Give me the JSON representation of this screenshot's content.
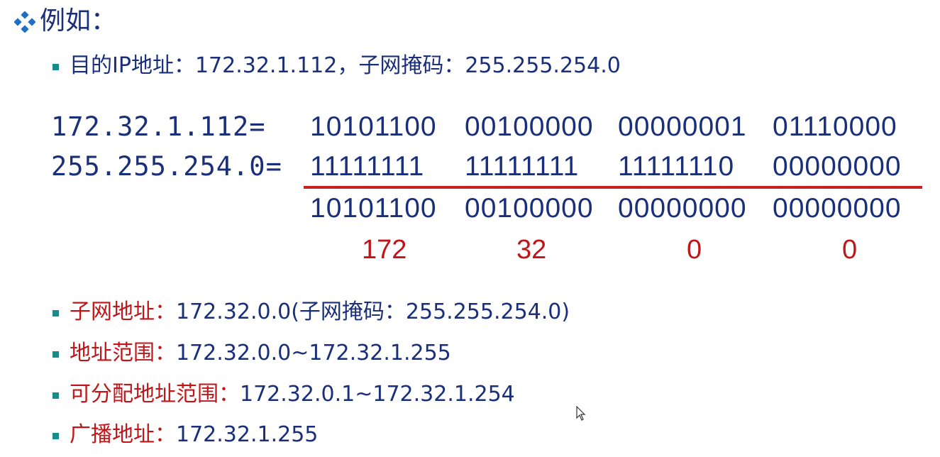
{
  "heading": {
    "text": "例如：",
    "icon": "diamond-bullet-icon"
  },
  "intro": {
    "label": "目的IP地址：",
    "ip": "172.32.1.112",
    "sep": "，",
    "mask_label": "子网掩码：",
    "mask": "255.255.254.0"
  },
  "calc": {
    "ip_label": "172.32.1.112=",
    "mask_label": "255.255.254.0=",
    "ip_bits": [
      "10101100",
      "00100000",
      "00000001",
      "01110000"
    ],
    "mask_bits": [
      "11111111",
      "11111111",
      "11111110",
      "00000000"
    ],
    "result_bits": [
      "10101100",
      "00100000",
      "00000000",
      "00000000"
    ],
    "result_dec": [
      "172",
      "32",
      "0",
      "0"
    ]
  },
  "results": [
    {
      "label": "子网地址：",
      "value": "172.32.0.0(子网掩码：255.255.254.0)"
    },
    {
      "label": "地址范围：",
      "value": "172.32.0.0~172.32.1.255"
    },
    {
      "label": "可分配地址范围：",
      "value": "172.32.0.1~172.32.1.254"
    },
    {
      "label": "广播地址：",
      "value": "172.32.1.255"
    }
  ],
  "colors": {
    "text": "#1a2f7a",
    "accent_red": "#c0161a",
    "bullet": "#1a8a8a"
  }
}
